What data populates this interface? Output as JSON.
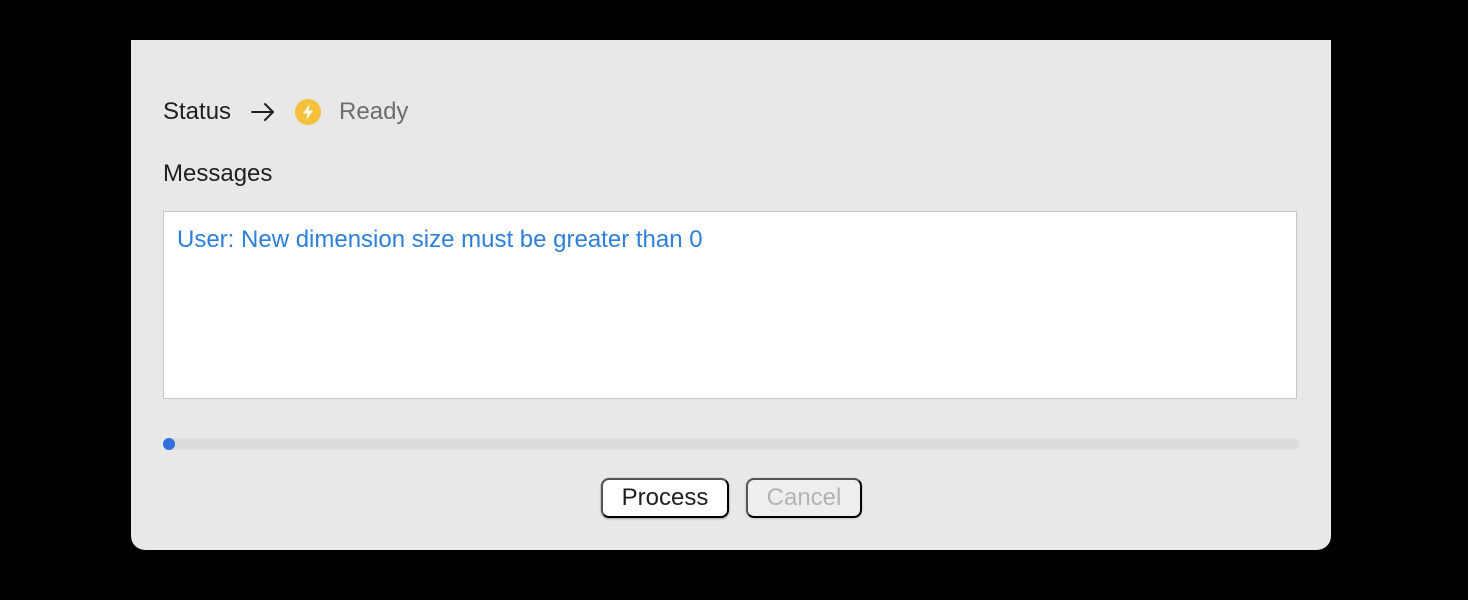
{
  "status": {
    "label": "Status",
    "arrow_icon": "arrow-right-icon",
    "state_icon": "lightning-bolt-icon",
    "value": "Ready",
    "state_color": "#f5c13a"
  },
  "messages": {
    "label": "Messages",
    "lines": [
      "User: New dimension size must be greater than 0"
    ],
    "line_color": "#2f7fd8"
  },
  "progress": {
    "value": 0
  },
  "buttons": {
    "process_label": "Process",
    "cancel_label": "Cancel",
    "cancel_enabled": false
  },
  "colors": {
    "accent": "#2f6fe0",
    "window_bg": "#e8e8e8"
  }
}
